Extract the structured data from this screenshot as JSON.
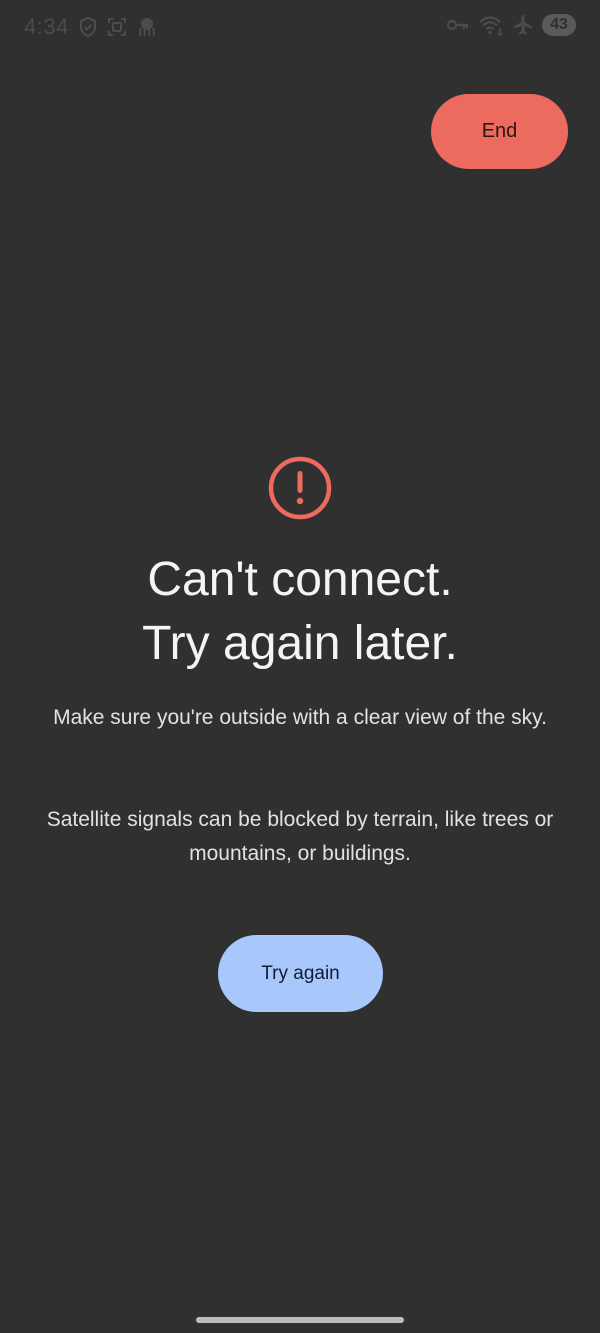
{
  "status_bar": {
    "time": "4:34",
    "battery_level": "43",
    "left_icons": [
      "shield-icon",
      "screenshot-icon",
      "octopus-icon"
    ],
    "right_icons": [
      "vpn-key-icon",
      "wifi-icon",
      "airplane-icon"
    ]
  },
  "colors": {
    "background": "#303030",
    "end_button": "#ec6b5e",
    "alert_icon": "#ec6b5e",
    "primary_button": "#a8c7fa"
  },
  "actions": {
    "end_label": "End",
    "try_again_label": "Try again"
  },
  "error": {
    "icon": "error-circle-icon",
    "title_line_1": "Can't connect.",
    "title_line_2": "Try again later.",
    "message_1": "Make sure you're outside with a clear view of the sky.",
    "message_2": "Satellite signals can be blocked by terrain, like trees or mountains, or buildings."
  }
}
